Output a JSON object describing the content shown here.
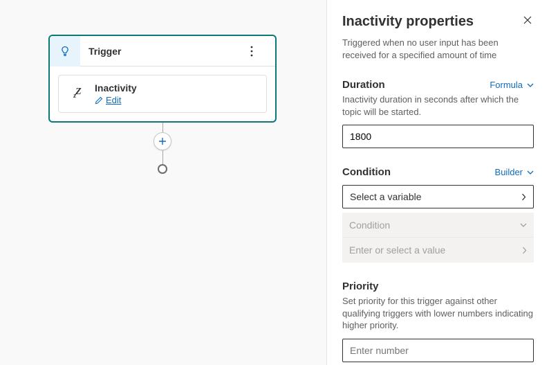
{
  "canvas": {
    "trigger_title": "Trigger",
    "inactivity_title": "Inactivity",
    "edit_label": "Edit"
  },
  "panel": {
    "title": "Inactivity properties",
    "description": "Triggered when no user input has been received for a specified amount of time",
    "duration": {
      "label": "Duration",
      "mode": "Formula",
      "description": "Inactivity duration in seconds after which the topic will be started.",
      "value": "1800"
    },
    "condition": {
      "label": "Condition",
      "mode": "Builder",
      "select_placeholder": "Select a variable",
      "row1": "Condition",
      "row2": "Enter or select a value"
    },
    "priority": {
      "label": "Priority",
      "description": "Set priority for this trigger against other qualifying triggers with lower numbers indicating higher priority.",
      "placeholder": "Enter number",
      "value": ""
    }
  }
}
